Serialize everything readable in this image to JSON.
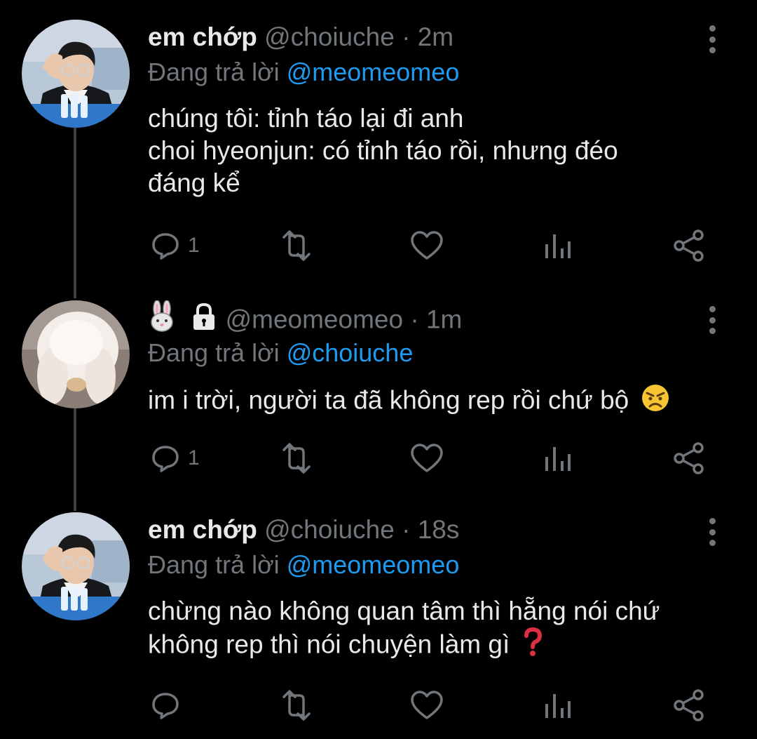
{
  "colors": {
    "background": "#000000",
    "text": "#e7e9ea",
    "muted": "#71767b",
    "link": "#1d9bf0",
    "thread_line": "#3e4144"
  },
  "tweets": [
    {
      "name": "em chớp",
      "handle": "@choiuche",
      "separator": "·",
      "time": "2m",
      "reply_prefix": "Đang trả lời",
      "reply_mention": "@meomeomeo",
      "text_lines": [
        "chúng tôi: tỉnh táo lại đi anh",
        "choi hyeonjun: có tỉnh táo rồi, nhưng đéo",
        "đáng kể"
      ],
      "reply_count": "1",
      "avatar_icon": "person-avatar"
    },
    {
      "name_icons": [
        "rabbit-emoji",
        "lock-icon"
      ],
      "handle": "@meomeomeo",
      "separator": "·",
      "time": "1m",
      "reply_prefix": "Đang trả lời",
      "reply_mention": "@choiuche",
      "text_lines": [
        "im i trời, người ta đã không rep rồi chứ bộ"
      ],
      "text_emoji": "angry-face-emoji",
      "reply_count": "1",
      "avatar_icon": "white-rabbit-avatar"
    },
    {
      "name": "em chớp",
      "handle": "@choiuche",
      "separator": "·",
      "time": "18s",
      "reply_prefix": "Đang trả lời",
      "reply_mention": "@meomeomeo",
      "text_lines": [
        "chừng nào không quan tâm thì hẵng nói chứ",
        "không rep thì nói chuyện làm gì"
      ],
      "text_emoji": "red-question-mark-emoji",
      "reply_count": "",
      "avatar_icon": "person-avatar"
    }
  ]
}
